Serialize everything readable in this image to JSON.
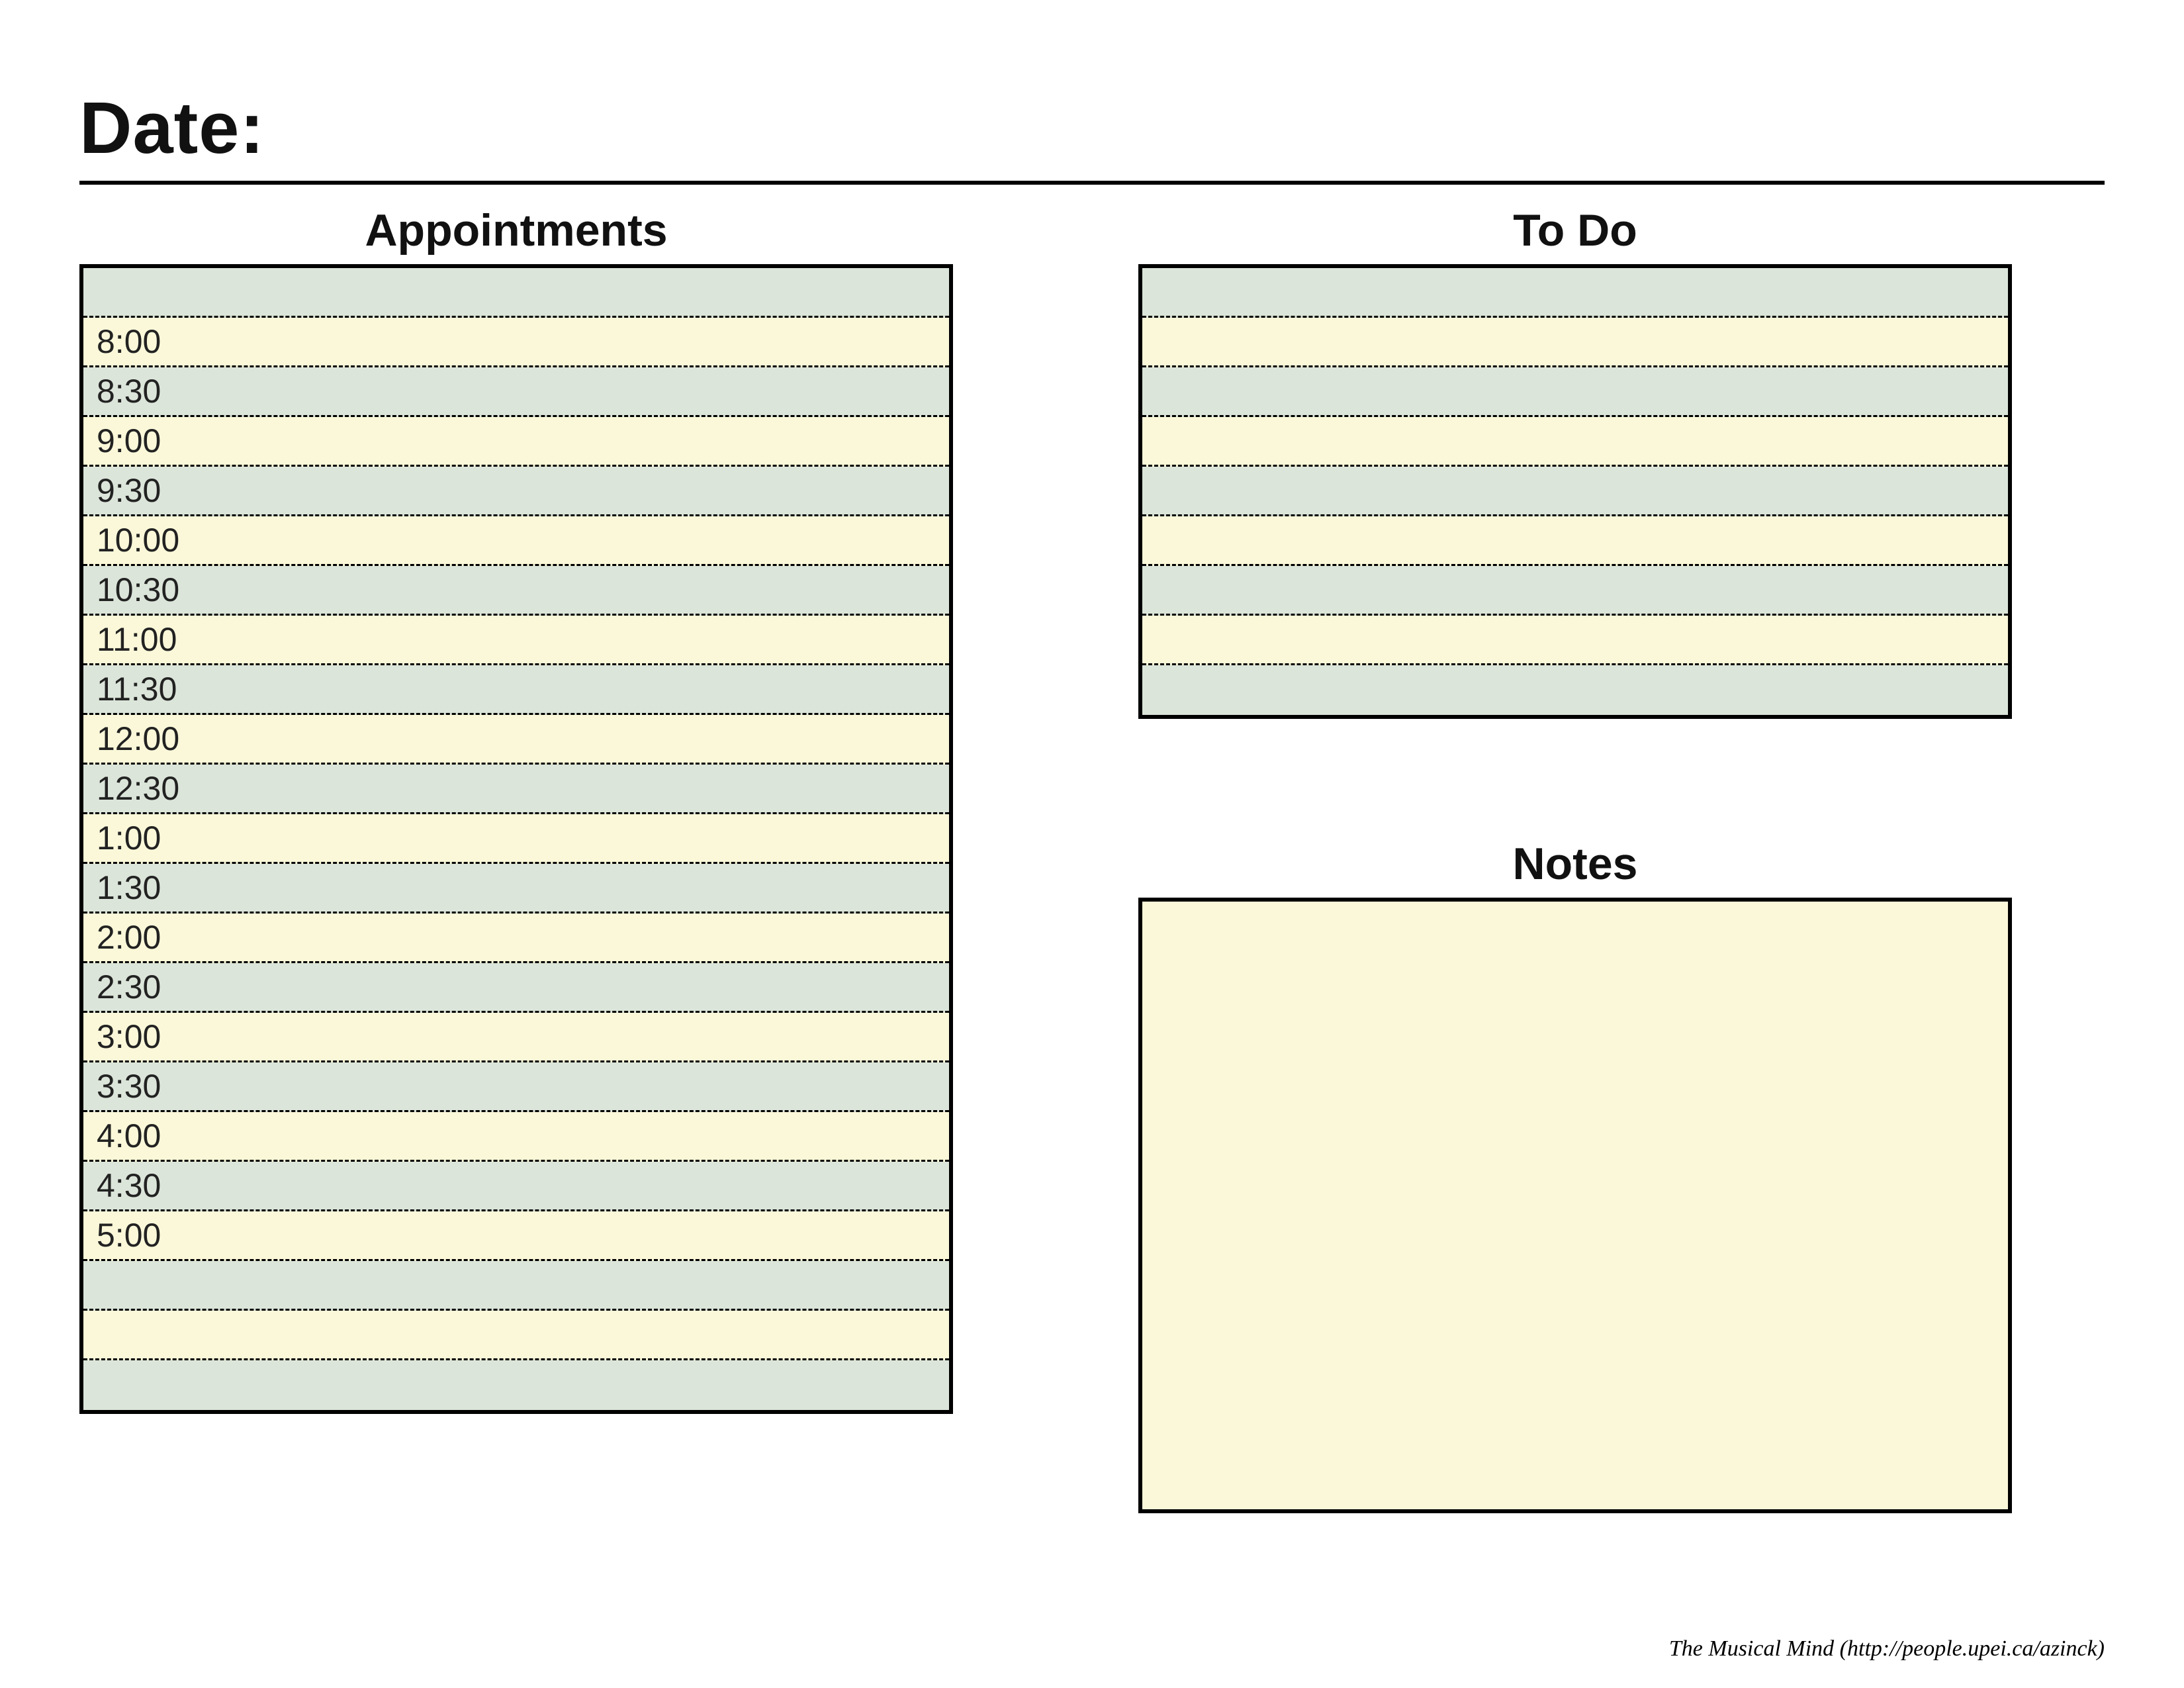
{
  "header": {
    "date_label": "Date:"
  },
  "appointments": {
    "title": "Appointments",
    "rows": [
      {
        "time": "",
        "shade": "green"
      },
      {
        "time": "8:00",
        "shade": "cream"
      },
      {
        "time": "8:30",
        "shade": "green"
      },
      {
        "time": "9:00",
        "shade": "cream"
      },
      {
        "time": "9:30",
        "shade": "green"
      },
      {
        "time": "10:00",
        "shade": "cream"
      },
      {
        "time": "10:30",
        "shade": "green"
      },
      {
        "time": "11:00",
        "shade": "cream"
      },
      {
        "time": "11:30",
        "shade": "green"
      },
      {
        "time": "12:00",
        "shade": "cream"
      },
      {
        "time": "12:30",
        "shade": "green"
      },
      {
        "time": "1:00",
        "shade": "cream"
      },
      {
        "time": "1:30",
        "shade": "green"
      },
      {
        "time": "2:00",
        "shade": "cream"
      },
      {
        "time": "2:30",
        "shade": "green"
      },
      {
        "time": "3:00",
        "shade": "cream"
      },
      {
        "time": "3:30",
        "shade": "green"
      },
      {
        "time": "4:00",
        "shade": "cream"
      },
      {
        "time": "4:30",
        "shade": "green"
      },
      {
        "time": "5:00",
        "shade": "cream"
      },
      {
        "time": "",
        "shade": "green"
      },
      {
        "time": "",
        "shade": "cream"
      },
      {
        "time": "",
        "shade": "green"
      }
    ]
  },
  "todo": {
    "title": "To Do",
    "rows": [
      {
        "shade": "green"
      },
      {
        "shade": "cream"
      },
      {
        "shade": "green"
      },
      {
        "shade": "cream"
      },
      {
        "shade": "green"
      },
      {
        "shade": "cream"
      },
      {
        "shade": "green"
      },
      {
        "shade": "cream"
      },
      {
        "shade": "green"
      }
    ]
  },
  "notes": {
    "title": "Notes"
  },
  "footer": {
    "text": "The Musical Mind   (http://people.upei.ca/azinck)"
  },
  "colors": {
    "green": "#dbe5d9",
    "cream": "#faf8d9",
    "border": "#000000"
  }
}
